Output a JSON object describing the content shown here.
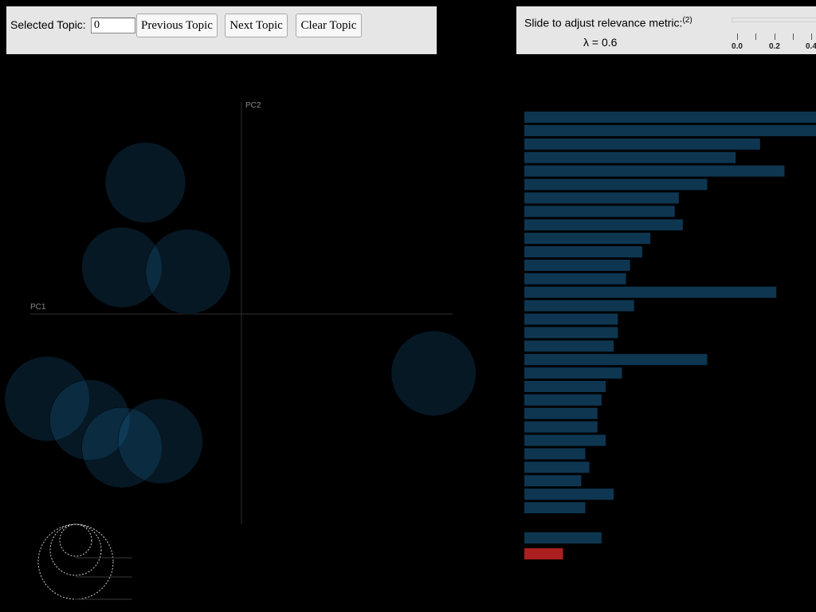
{
  "topic_panel": {
    "label": "Selected Topic:",
    "input_value": "0",
    "prev_label": "Previous Topic",
    "next_label": "Next Topic",
    "clear_label": "Clear Topic"
  },
  "slider": {
    "title": "Slide to adjust relevance metric:",
    "footnote": "(2)",
    "lambda_text": "λ = 0.6",
    "lambda": 0.6,
    "tick_labels": [
      "0.0",
      "0.2",
      "0.4"
    ]
  },
  "map": {
    "pc1_label": "PC1",
    "pc2_label": "PC2",
    "circle_fill": "#1f77b4",
    "axis_color": "#3a3a3a",
    "topics": [
      {
        "x": -0.45,
        "y": 0.62,
        "size": 0.18
      },
      {
        "x": -0.56,
        "y": 0.22,
        "size": 0.18
      },
      {
        "x": -0.25,
        "y": 0.2,
        "size": 0.19
      },
      {
        "x": 0.9,
        "y": -0.28,
        "size": 0.19
      },
      {
        "x": -0.91,
        "y": -0.4,
        "size": 0.19
      },
      {
        "x": -0.71,
        "y": -0.5,
        "size": 0.18
      },
      {
        "x": -0.56,
        "y": -0.63,
        "size": 0.18
      },
      {
        "x": -0.38,
        "y": -0.6,
        "size": 0.19
      }
    ]
  },
  "chart_data": {
    "type": "bar",
    "orientation": "horizontal",
    "bar_color": "#1f77b4",
    "highlight_color": "#d62728",
    "values": [
      0.72,
      0.72,
      0.58,
      0.52,
      0.64,
      0.45,
      0.38,
      0.37,
      0.39,
      0.31,
      0.29,
      0.26,
      0.25,
      0.62,
      0.27,
      0.23,
      0.23,
      0.22,
      0.45,
      0.24,
      0.2,
      0.19,
      0.18,
      0.18,
      0.2,
      0.15,
      0.16,
      0.14,
      0.22,
      0.15
    ],
    "extra_bar": 0.19,
    "highlight_bar": 0.095
  },
  "size_legend": {
    "rings": [
      {
        "size": 0.09
      },
      {
        "size": 0.06
      },
      {
        "size": 0.04
      }
    ]
  }
}
